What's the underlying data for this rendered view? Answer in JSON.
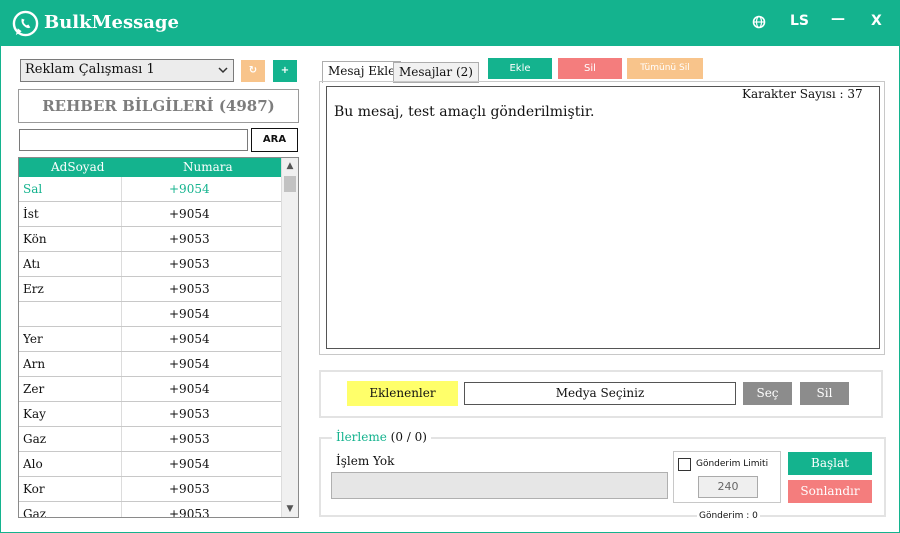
{
  "window": {
    "title": "BulkMessage",
    "buttons": {
      "settings_icon": "globe-icon",
      "user_label": "LS",
      "minimize_label": "—",
      "close_label": "X"
    }
  },
  "left": {
    "group_select": {
      "value": "Reklam Çalışması 1"
    },
    "reset_button_label": "↻",
    "add_button_label": "+",
    "contacts_title": "REHBER BİLGİLERİ (4987)",
    "search": {
      "value": "",
      "button_label": "ARA"
    },
    "table": {
      "columns": [
        "AdSoyad",
        "Numara"
      ],
      "rows": [
        {
          "name": "Sal",
          "number": "+9054",
          "active": true
        },
        {
          "name": "İst",
          "number": "+9054"
        },
        {
          "name": "Kön",
          "number": "+9053"
        },
        {
          "name": "Atı",
          "number": "+9053"
        },
        {
          "name": "Erz",
          "number": "+9053"
        },
        {
          "name": "",
          "number": "+9054"
        },
        {
          "name": "Yer",
          "number": "+9054"
        },
        {
          "name": "Arn",
          "number": "+9054"
        },
        {
          "name": "Zer",
          "number": "+9054"
        },
        {
          "name": "Kay",
          "number": "+9053"
        },
        {
          "name": "Gaz",
          "number": "+9053"
        },
        {
          "name": "Alo",
          "number": "+9054"
        },
        {
          "name": "Kor",
          "number": "+9053"
        },
        {
          "name": "Gaz",
          "number": "+9053"
        }
      ]
    }
  },
  "right": {
    "tabs": [
      "Mesaj Ekle",
      "Mesajlar (2)"
    ],
    "actions": {
      "add": "Ekle",
      "delete": "Sil",
      "delete_all": "Tümünü Sil"
    },
    "character_count": "Karakter Sayısı : 37",
    "message_text": "Bu mesaj, test amaçlı gönderilmiştir.",
    "media": {
      "added_label": "Eklenenler",
      "field_text": "Medya Seçiniz",
      "choose_label": "Seç",
      "delete_label": "Sil"
    },
    "progress": {
      "legend": "İlerleme",
      "count": "(0 / 0)",
      "status": "İşlem Yok",
      "progress_fraction": 0,
      "limit_label": "Gönderim Limiti",
      "limit_value": "240",
      "sent_label": "Gönderim : 0",
      "start_label": "Başlat",
      "stop_label": "Sonlandır"
    }
  },
  "colors": {
    "accent": "#14b38e",
    "danger": "#f47d7d",
    "warning": "#f8c48b",
    "highlight": "#ffff6a"
  }
}
